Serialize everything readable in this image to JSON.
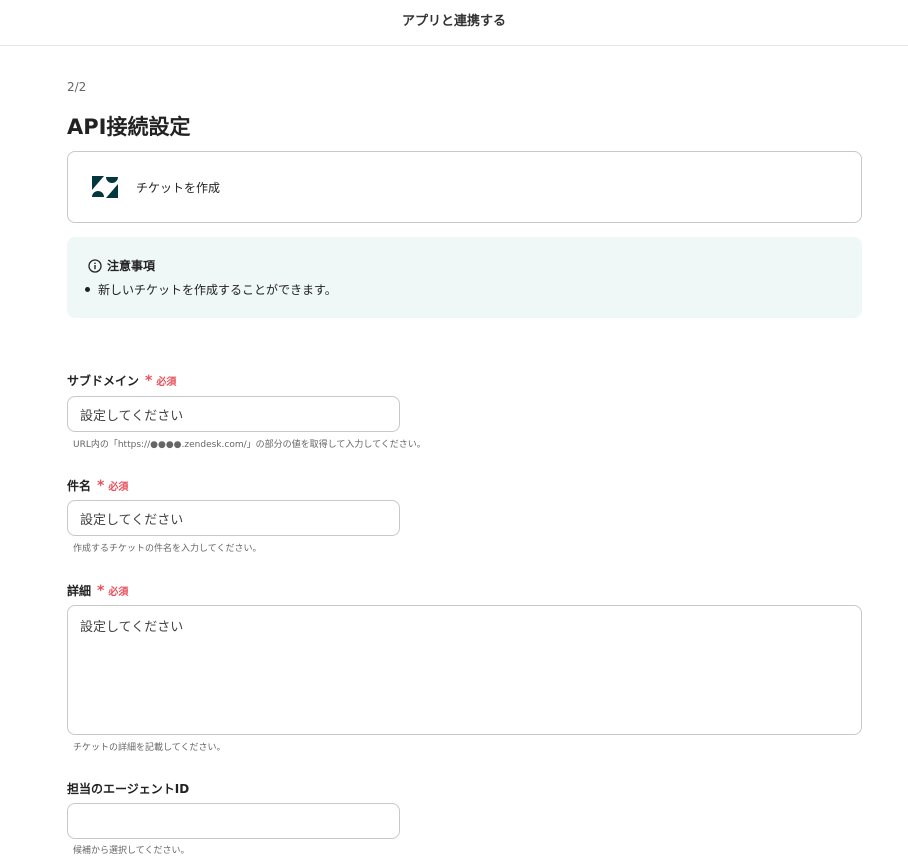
{
  "header": {
    "title": "アプリと連携する"
  },
  "step": "2/2",
  "page_title": "API接続設定",
  "action": {
    "app_icon": "zendesk-logo",
    "label": "チケットを作成"
  },
  "notice": {
    "icon": "info-icon",
    "title": "注意事項",
    "items": [
      "新しいチケットを作成することができます。"
    ]
  },
  "colors": {
    "required": "#e8505b",
    "notice_bg": "#eff8f6",
    "logo": "#03363d"
  },
  "fields": [
    {
      "label": "サブドメイン",
      "required": true,
      "required_text": "必須",
      "placeholder": "設定してください",
      "hint": "URL内の「https://●●●●.zendesk.com/」の部分の値を取得して入力してください。"
    },
    {
      "label": "件名",
      "required": true,
      "required_text": "必須",
      "placeholder": "設定してください",
      "hint": "作成するチケットの件名を入力してください。"
    },
    {
      "label": "詳細",
      "required": true,
      "required_text": "必須",
      "placeholder": "設定してください",
      "hint": "チケットの詳細を記載してください。"
    },
    {
      "label": "担当のエージェントID",
      "required": false,
      "placeholder": "",
      "hint": "候補から選択してください。"
    }
  ]
}
